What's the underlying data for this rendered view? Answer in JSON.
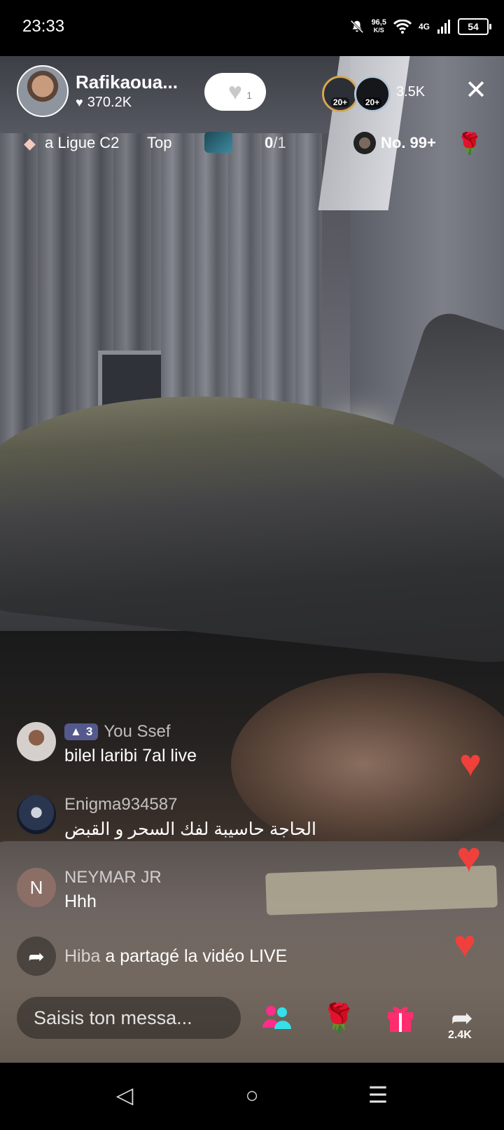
{
  "status_bar": {
    "time": "23:33",
    "speed_value": "96,5",
    "speed_unit": "K/S",
    "network": "4G",
    "battery": "54"
  },
  "header": {
    "host_name": "Rafikaoua...",
    "host_likes": "370.2K",
    "follow_count": "1",
    "viewer_badge_1": "20+",
    "viewer_badge_2": "20+",
    "viewer_count": "3.5K"
  },
  "league_bar": {
    "league_text": "a Ligue C2",
    "top_label": "Top",
    "score": "0",
    "score_total": "/1",
    "rank_label": "No. 99+"
  },
  "comments": [
    {
      "user": "You Ssef",
      "level": "3",
      "text": "bilel laribi 7al live"
    },
    {
      "user": "Enigma934587",
      "text": "الحاجة حاسيبة  لفك السحر و القبض"
    },
    {
      "user": "NEYMAR JR",
      "avatar_letter": "N",
      "text": "Hhh"
    }
  ],
  "share_note": {
    "user": "Hiba",
    "text": "a partagé la vidéo LIVE"
  },
  "bottom_bar": {
    "message_placeholder": "Saisis ton messa...",
    "share_count": "2.4K"
  },
  "colors": {
    "heart_red": "#f0403c",
    "gift_pink": "#ff2d6f",
    "multi_guest_pink": "#ff2d8a",
    "multi_guest_cyan": "#35e0e8"
  },
  "icons": [
    "bell-off-icon",
    "wifi-icon",
    "signal-icon",
    "battery-icon",
    "heart-icon",
    "close-icon",
    "diamond-icon",
    "share-arrow-icon",
    "multi-guest-icon",
    "rose-icon",
    "gift-icon",
    "back-icon",
    "home-icon",
    "menu-icon"
  ]
}
